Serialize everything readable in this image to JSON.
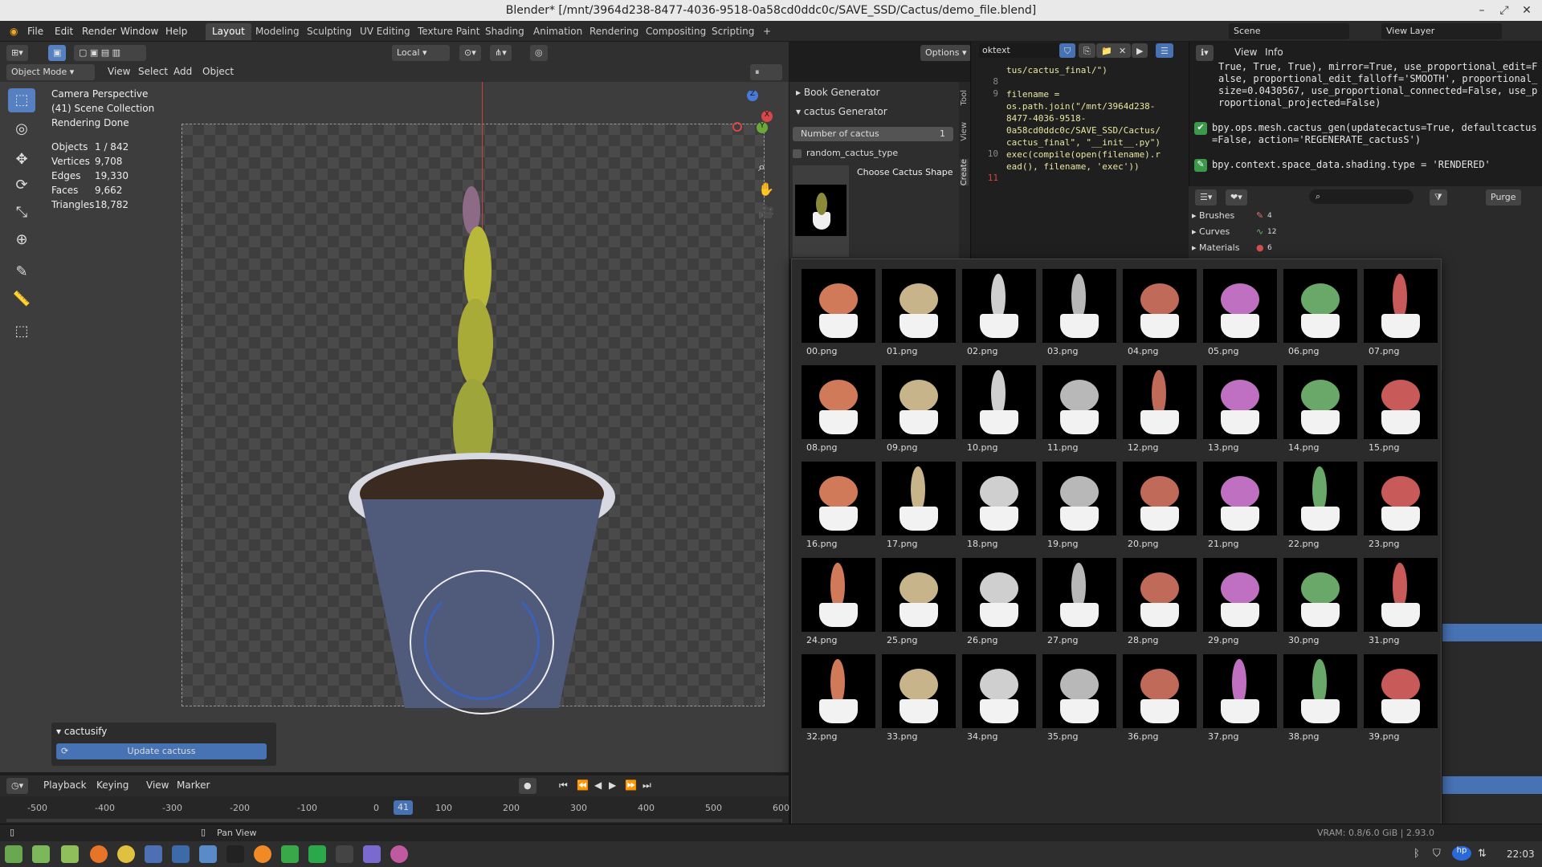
{
  "window": {
    "title": "Blender* [/mnt/3964d238-8477-4036-9518-0a58cd0ddc0c/SAVE_SSD/Cactus/demo_file.blend]",
    "min": "–",
    "max": "⤢",
    "close": "✕"
  },
  "menu": [
    "File",
    "Edit",
    "Render",
    "Window",
    "Help"
  ],
  "workspaces": [
    "Layout",
    "Modeling",
    "Sculpting",
    "UV Editing",
    "Texture Paint",
    "Shading",
    "Animation",
    "Rendering",
    "Compositing",
    "Scripting"
  ],
  "add_workspace": "+",
  "scene": {
    "label": "Scene",
    "view_layer": "View Layer"
  },
  "viewport": {
    "mode": "Object Mode",
    "menus": [
      "View",
      "Select",
      "Add",
      "Object"
    ],
    "transform_orientation": "Local",
    "options": "Options",
    "overlay": {
      "camera": "Camera Perspective",
      "collection": "(41) Scene Collection",
      "status": "Rendering Done",
      "stats": [
        {
          "label": "Objects",
          "value": "1 / 842"
        },
        {
          "label": "Vertices",
          "value": "9,708"
        },
        {
          "label": "Edges",
          "value": "19,330"
        },
        {
          "label": "Faces",
          "value": "9,662"
        },
        {
          "label": "Triangles",
          "value": "18,782"
        }
      ]
    },
    "cactusify": {
      "header": "cactusify",
      "button": "Update cactuss"
    }
  },
  "npanel": {
    "book_generator": "Book Generator",
    "cactus_generator": "cactus Generator",
    "number_label": "Number of cactus",
    "number_value": "1",
    "random_label": "random_cactus_type",
    "choose_label": "Choose Cactus Shape",
    "tabs": [
      "Tool",
      "View",
      "Create"
    ]
  },
  "text_editor": {
    "filename": "oktext",
    "lines": [
      {
        "n": "",
        "code": "tus/cactus_final/\")"
      },
      {
        "n": "8",
        "code": ""
      },
      {
        "n": "9",
        "code": "filename ="
      },
      {
        "n": "",
        "code": "os.path.join(\"/mnt/3964d238-"
      },
      {
        "n": "",
        "code": "8477-4036-9518-"
      },
      {
        "n": "",
        "code": "0a58cd0ddc0c/SAVE_SSD/Cactus/"
      },
      {
        "n": "",
        "code": "cactus_final\", \"__init__.py\")"
      },
      {
        "n": "10",
        "code": "exec(compile(open(filename).r"
      },
      {
        "n": "",
        "code": "ead(), filename, 'exec'))"
      },
      {
        "n": "11",
        "code": ""
      }
    ]
  },
  "info": {
    "menus": [
      "View",
      "Info"
    ],
    "log_prev": "True, True, True), mirror=True, use_proportional_edit=False, proportional_edit_falloff='SMOOTH', proportional_size=0.0430567, use_proportional_connected=False, use_proportional_projected=False)",
    "op1": "bpy.ops.mesh.cactus_gen(updatecactus=True, defaultcactus=False, action='REGENERATE_cactusS')",
    "op2": "bpy.context.space_data.shading.type = 'RENDERED'"
  },
  "outliner": {
    "purge": "Purge",
    "items": [
      {
        "label": "Brushes",
        "count": "4"
      },
      {
        "label": "Curves",
        "count": "12"
      },
      {
        "label": "Materials",
        "count": "6"
      }
    ]
  },
  "gallery": {
    "items": [
      "00.png",
      "01.png",
      "02.png",
      "03.png",
      "04.png",
      "05.png",
      "06.png",
      "07.png",
      "08.png",
      "09.png",
      "10.png",
      "11.png",
      "12.png",
      "13.png",
      "14.png",
      "15.png",
      "16.png",
      "17.png",
      "18.png",
      "19.png",
      "20.png",
      "21.png",
      "22.png",
      "23.png",
      "24.png",
      "25.png",
      "26.png",
      "27.png",
      "28.png",
      "29.png",
      "30.png",
      "31.png",
      "32.png",
      "33.png",
      "34.png",
      "35.png",
      "36.png",
      "37.png",
      "38.png",
      "39.png"
    ]
  },
  "timeline": {
    "menus": [
      "Playback",
      "Keying",
      "View",
      "Marker"
    ],
    "current_frame": "41",
    "ticks": [
      "-500",
      "-400",
      "-300",
      "-200",
      "-100",
      "0",
      "100",
      "200",
      "300",
      "400",
      "500",
      "600"
    ]
  },
  "statusbar": {
    "hint": "Pan View",
    "version": "VRAM: 0.8/6.0 GiB | 2.93.0"
  },
  "taskbar": {
    "time": "22:03"
  }
}
